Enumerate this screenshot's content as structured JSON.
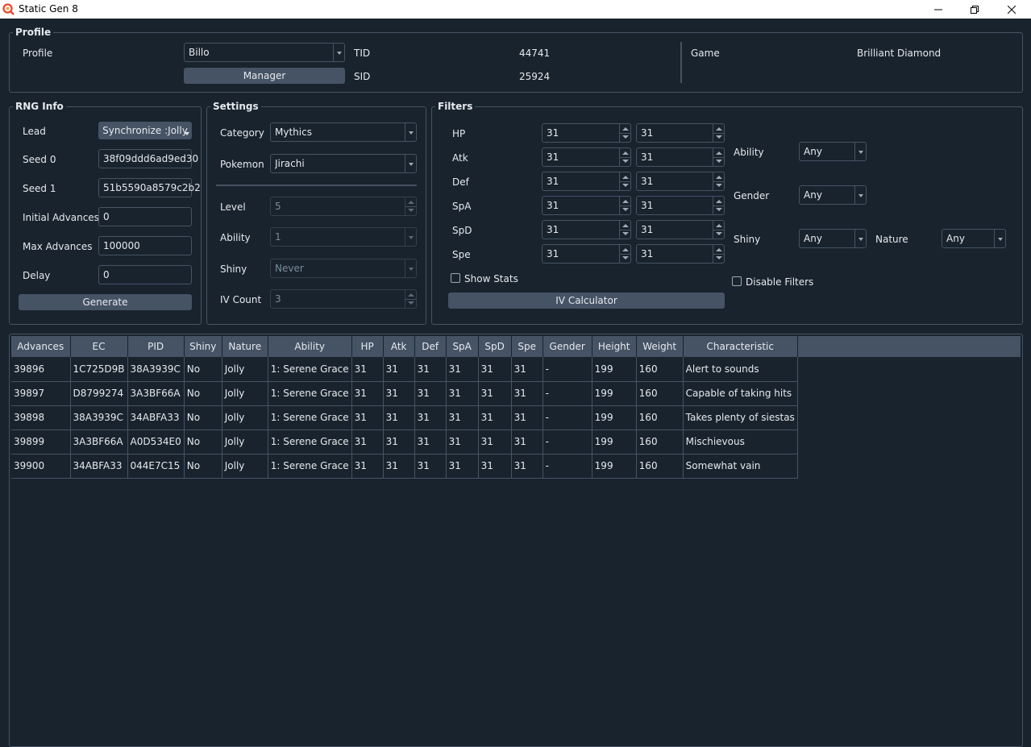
{
  "window": {
    "title": "Static Gen 8"
  },
  "profile": {
    "group_title": "Profile",
    "profile_label": "Profile",
    "profile_value": "Billo",
    "manager_label": "Manager",
    "tid_label": "TID",
    "tid_value": "44741",
    "sid_label": "SID",
    "sid_value": "25924",
    "game_label": "Game",
    "game_value": "Brilliant Diamond"
  },
  "rng": {
    "group_title": "RNG Info",
    "lead_label": "Lead",
    "lead_value": "Synchronize :Jolly",
    "seed0_label": "Seed 0",
    "seed0_value": "38f09ddd6ad9ed30",
    "seed1_label": "Seed 1",
    "seed1_value": "51b5590a8579c2b2",
    "initial_label": "Initial Advances",
    "initial_value": "0",
    "max_label": "Max Advances",
    "max_value": "100000",
    "delay_label": "Delay",
    "delay_value": "0",
    "generate_label": "Generate"
  },
  "settings": {
    "group_title": "Settings",
    "category_label": "Category",
    "category_value": "Mythics",
    "pokemon_label": "Pokemon",
    "pokemon_value": "Jirachi",
    "level_label": "Level",
    "level_value": "5",
    "ability_label": "Ability",
    "ability_value": "1",
    "shiny_label": "Shiny",
    "shiny_value": "Never",
    "ivcount_label": "IV Count",
    "ivcount_value": "3"
  },
  "filters": {
    "group_title": "Filters",
    "iv_rows": [
      {
        "label": "HP",
        "min": "31",
        "max": "31"
      },
      {
        "label": "Atk",
        "min": "31",
        "max": "31"
      },
      {
        "label": "Def",
        "min": "31",
        "max": "31"
      },
      {
        "label": "SpA",
        "min": "31",
        "max": "31"
      },
      {
        "label": "SpD",
        "min": "31",
        "max": "31"
      },
      {
        "label": "Spe",
        "min": "31",
        "max": "31"
      }
    ],
    "show_stats_label": "Show Stats",
    "iv_calc_label": "IV Calculator",
    "ability_label": "Ability",
    "ability_value": "Any",
    "gender_label": "Gender",
    "gender_value": "Any",
    "shiny_label": "Shiny",
    "shiny_value": "Any",
    "nature_label": "Nature",
    "nature_value": "Any",
    "disable_label": "Disable Filters"
  },
  "results": {
    "columns": [
      "Advances",
      "EC",
      "PID",
      "Shiny",
      "Nature",
      "Ability",
      "HP",
      "Atk",
      "Def",
      "SpA",
      "SpD",
      "Spe",
      "Gender",
      "Height",
      "Weight",
      "Characteristic"
    ],
    "rows": [
      [
        "39896",
        "1C725D9B",
        "38A3939C",
        "No",
        "Jolly",
        "1: Serene Grace",
        "31",
        "31",
        "31",
        "31",
        "31",
        "31",
        "-",
        "199",
        "160",
        "Alert to sounds"
      ],
      [
        "39897",
        "D8799274",
        "3A3BF66A",
        "No",
        "Jolly",
        "1: Serene Grace",
        "31",
        "31",
        "31",
        "31",
        "31",
        "31",
        "-",
        "199",
        "160",
        "Capable of taking hits"
      ],
      [
        "39898",
        "38A3939C",
        "34ABFA33",
        "No",
        "Jolly",
        "1: Serene Grace",
        "31",
        "31",
        "31",
        "31",
        "31",
        "31",
        "-",
        "199",
        "160",
        "Takes plenty of siestas"
      ],
      [
        "39899",
        "3A3BF66A",
        "A0D534E0",
        "No",
        "Jolly",
        "1: Serene Grace",
        "31",
        "31",
        "31",
        "31",
        "31",
        "31",
        "-",
        "199",
        "160",
        "Mischievous"
      ],
      [
        "39900",
        "34ABFA33",
        "044E7C15",
        "No",
        "Jolly",
        "1: Serene Grace",
        "31",
        "31",
        "31",
        "31",
        "31",
        "31",
        "-",
        "199",
        "160",
        "Somewhat vain"
      ]
    ]
  }
}
